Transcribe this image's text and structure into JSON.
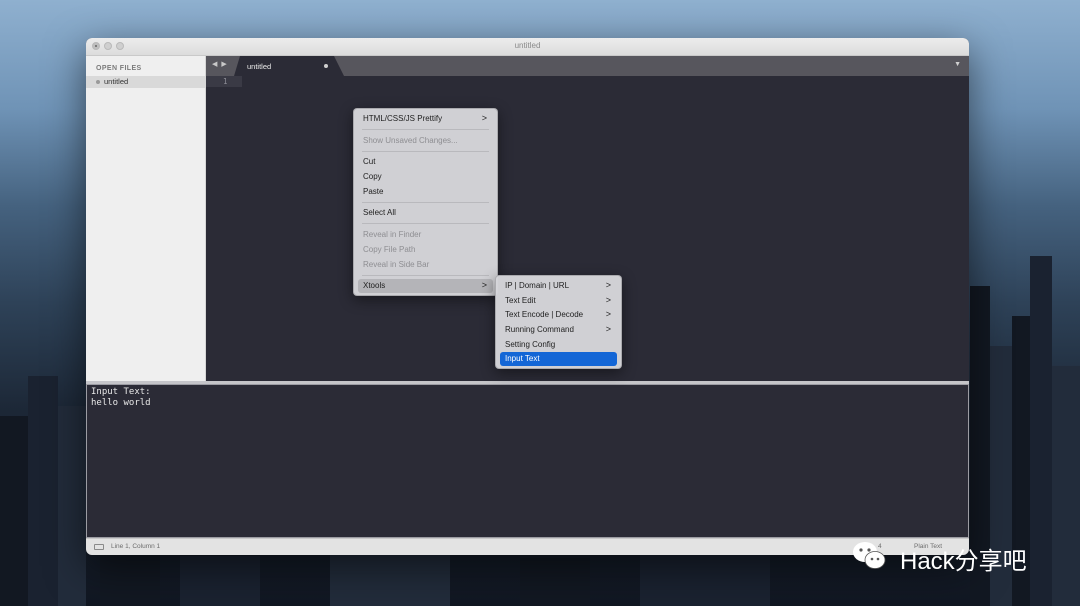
{
  "window": {
    "title": "untitled"
  },
  "sidebar": {
    "heading": "OPEN FILES",
    "files": [
      {
        "name": "untitled"
      }
    ]
  },
  "tabbar": {
    "nav_arrows": "◀ ▶",
    "active_tab": "untitled",
    "dropdown": "▼"
  },
  "editor": {
    "line_numbers": [
      "1"
    ]
  },
  "context_menu": {
    "items": [
      {
        "label": "HTML/CSS/JS Prettify",
        "submenu": true,
        "enabled": true
      },
      {
        "label": "Show Unsaved Changes...",
        "enabled": false
      },
      {
        "label": "Cut",
        "enabled": true
      },
      {
        "label": "Copy",
        "enabled": true
      },
      {
        "label": "Paste",
        "enabled": true
      },
      {
        "label": "Select All",
        "enabled": true
      },
      {
        "label": "Reveal in Finder",
        "enabled": false
      },
      {
        "label": "Copy File Path",
        "enabled": false
      },
      {
        "label": "Reveal in Side Bar",
        "enabled": false
      },
      {
        "label": "Xtools",
        "submenu": true,
        "enabled": true,
        "highlighted": true
      }
    ]
  },
  "submenu": {
    "items": [
      {
        "label": "IP | Domain | URL",
        "submenu": true
      },
      {
        "label": "Text Edit",
        "submenu": true
      },
      {
        "label": "Text Encode | Decode",
        "submenu": true
      },
      {
        "label": "Running Command",
        "submenu": true
      },
      {
        "label": "Setting Config",
        "submenu": false
      },
      {
        "label": "Input Text",
        "submenu": false,
        "selected": true
      }
    ]
  },
  "output_panel": {
    "lines": [
      "Input Text:",
      "hello world"
    ]
  },
  "statusbar": {
    "position": "Line 1, Column 1",
    "tab_size": "4",
    "syntax": "Plain Text"
  },
  "watermark": {
    "text": "Hack分享吧"
  },
  "colors": {
    "highlight_blue": "#1366d6",
    "editor_bg": "#2b2b36"
  },
  "icons": {
    "submenu_arrow": ">"
  }
}
